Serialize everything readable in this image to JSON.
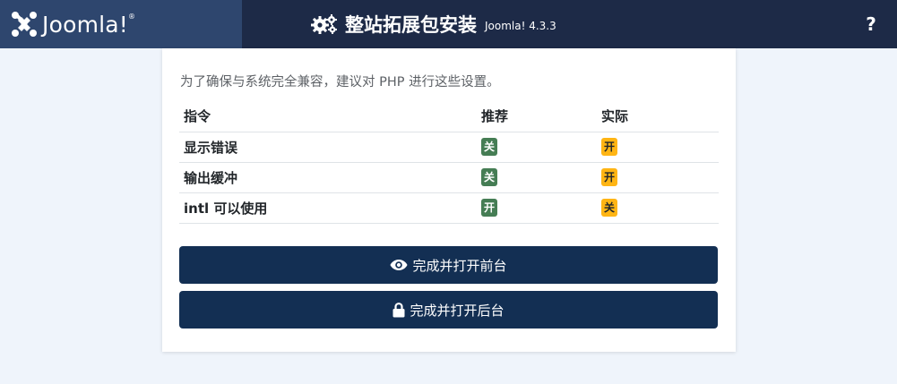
{
  "header": {
    "logo_text": "Joomla!",
    "logo_tm": "®",
    "title": "整站拓展包安装",
    "version": "Joomla! 4.3.3",
    "help_label": "?"
  },
  "content": {
    "intro": "为了确保与系统完全兼容，建议对 PHP 进行这些设置。",
    "table": {
      "headers": [
        "指令",
        "推荐",
        "实际"
      ],
      "rows": [
        {
          "directive": "显示错误",
          "recommended": "关",
          "actual": "开"
        },
        {
          "directive": "输出缓冲",
          "recommended": "关",
          "actual": "开"
        },
        {
          "directive": "intl 可以使用",
          "recommended": "开",
          "actual": "关"
        }
      ]
    },
    "buttons": {
      "open_site": "完成并打开前台",
      "open_admin": "完成并打开后台"
    }
  },
  "colors": {
    "header_bg": "#1d2a47",
    "logo_bg": "#2e466e",
    "button_bg": "#132f53",
    "badge_green": "#457d54",
    "badge_yellow": "#ffb514"
  },
  "icons": {
    "logo": "joomla-logo-icon",
    "title": "gears-icon",
    "help": "question-icon",
    "open_site": "eye-icon",
    "open_admin": "lock-icon"
  }
}
